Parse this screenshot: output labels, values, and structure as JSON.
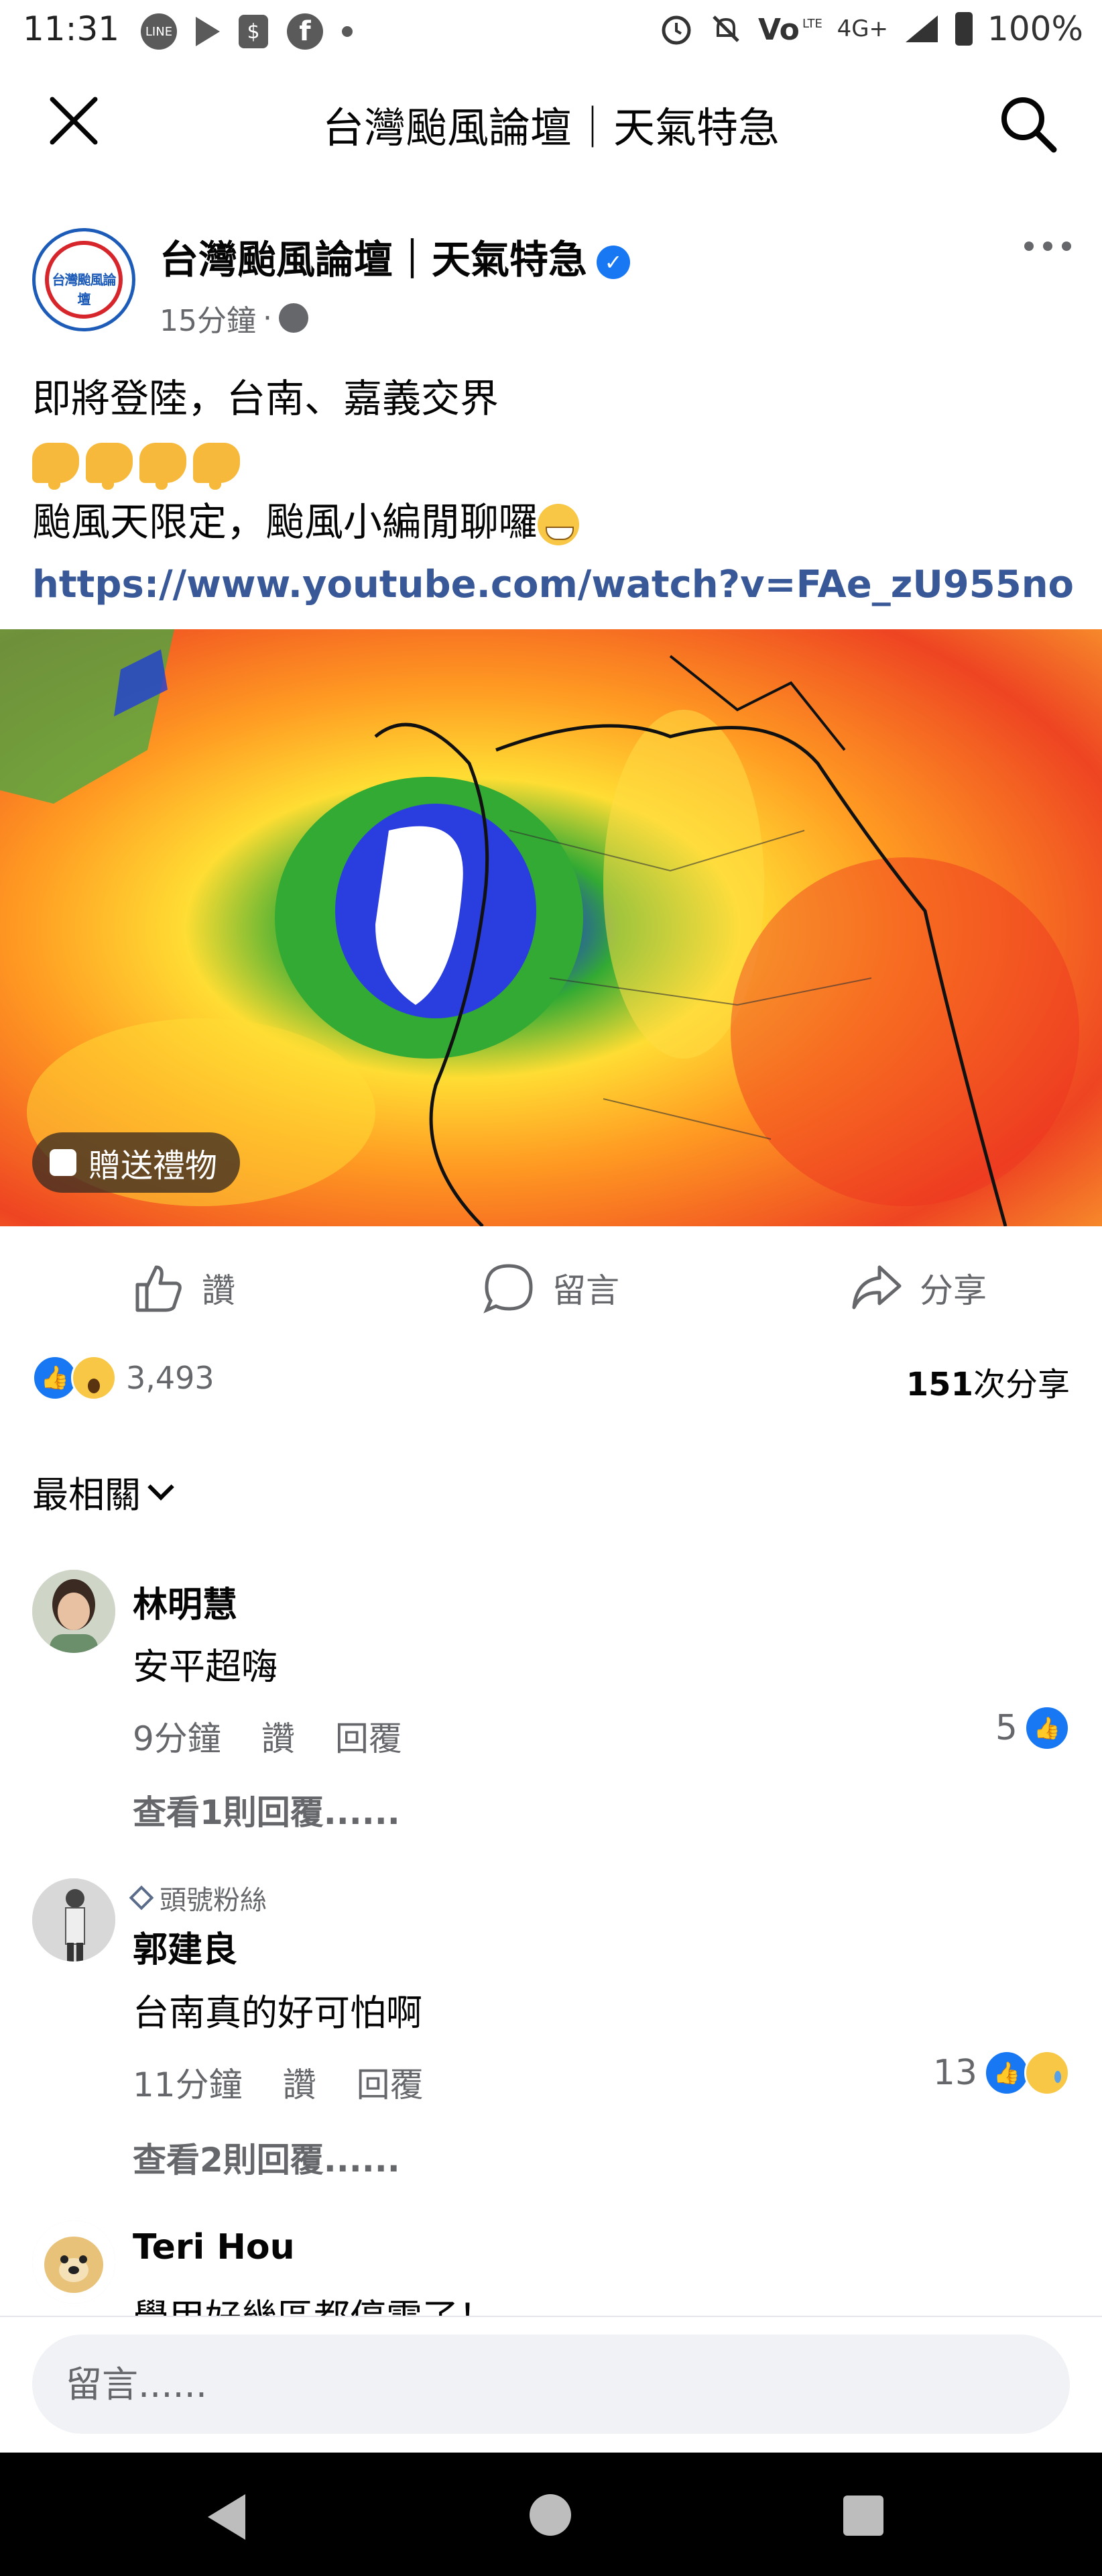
{
  "status_bar": {
    "time": "11:31",
    "network": "4G+",
    "battery": "100%",
    "notifications": [
      "line-icon",
      "play-icon",
      "shopping-bag-icon",
      "facebook-icon",
      "dot-icon"
    ],
    "right_icons": [
      "alarm-icon",
      "mute-icon",
      "volte-icon",
      "signal-icon",
      "battery-icon"
    ]
  },
  "header": {
    "title": "台灣颱風論壇｜天氣特急"
  },
  "post": {
    "page_name": "台灣颱風論壇｜天氣特急",
    "avatar_text": "台灣颱風論壇",
    "time": "15分鐘",
    "separator": "·",
    "line1": "即將登陸，台南、嘉義交界",
    "line3": "颱風天限定，颱風小編閒聊囉",
    "link": "https://www.youtube.com/watch?v=FAe_zU955no",
    "image_description": "radar",
    "gift_label": "贈送禮物"
  },
  "actions": {
    "like": "讚",
    "comment": "留言",
    "share": "分享"
  },
  "reactions": {
    "count": "3,493",
    "shares_count": "151",
    "shares_suffix": "次分享"
  },
  "sort": {
    "label": "最相關"
  },
  "comments": [
    {
      "name": "林明慧",
      "text": "安平超嗨",
      "time": "9分鐘",
      "like": "讚",
      "reply": "回覆",
      "reactions": "5",
      "view_replies": "查看1則回覆......"
    },
    {
      "badge": "頭號粉絲",
      "name": "郭建良",
      "text": "台南真的好可怕啊",
      "time": "11分鐘",
      "like": "讚",
      "reply": "回覆",
      "reactions": "13",
      "view_replies": "查看2則回覆......"
    },
    {
      "name": "Teri Hou",
      "text": "學甲好幾區都停電了！"
    }
  ],
  "comment_input": {
    "placeholder": "留言......"
  },
  "colors": {
    "facebook_blue": "#1877f2",
    "link_blue": "#385898",
    "secondary_text": "#65676b"
  }
}
